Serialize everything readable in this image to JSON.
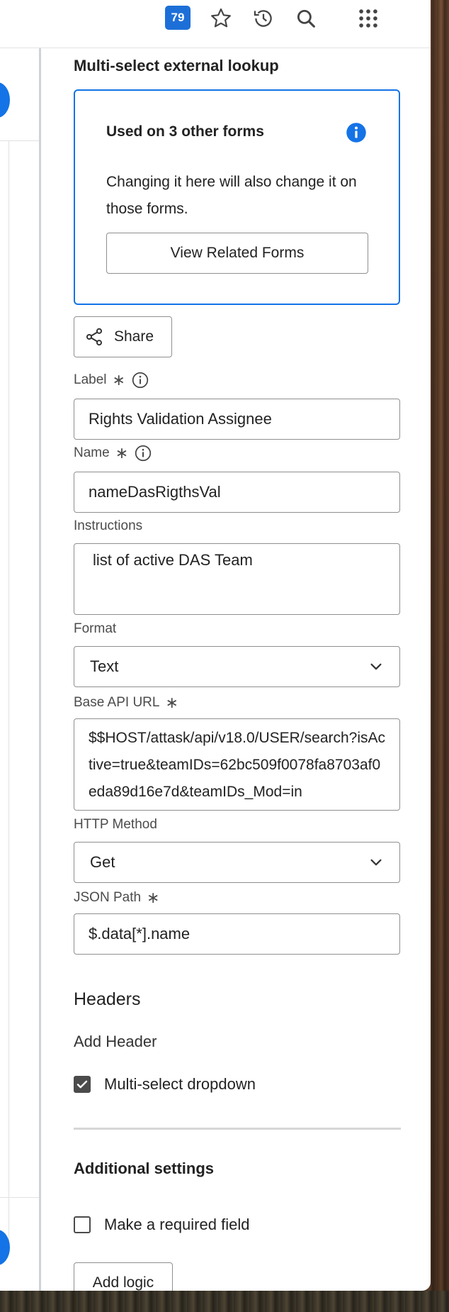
{
  "toolbar": {
    "notification_count": "79",
    "icons": [
      "star-icon",
      "history-icon",
      "search-icon",
      "apps-grid-icon"
    ]
  },
  "panel": {
    "title": "Multi-select external lookup",
    "info_card": {
      "title": "Used on 3 other forms",
      "body": "Changing it here will also change it on those forms.",
      "button_label": "View Related Forms"
    },
    "share_label": "Share",
    "fields": {
      "label": {
        "label": "Label",
        "value": "Rights Validation Assignee"
      },
      "name": {
        "label": "Name",
        "value": "nameDasRigthsVal"
      },
      "instructions": {
        "label": "Instructions",
        "value": "list of active DAS Team"
      },
      "format": {
        "label": "Format",
        "value": "Text"
      },
      "base_api_url": {
        "label": "Base API URL",
        "value": "$$HOST/attask/api/v18.0/USER/search?isActive=true&teamIDs=62bc509f0078fa8703af0eda89d16e7d&teamIDs_Mod=in"
      },
      "http_method": {
        "label": "HTTP Method",
        "value": "Get"
      },
      "json_path": {
        "label": "JSON Path",
        "value": "$.data[*].name"
      }
    },
    "headers": {
      "heading": "Headers",
      "add_header": "Add Header"
    },
    "multiselect": {
      "label": "Multi-select dropdown",
      "checked": true
    },
    "additional": {
      "heading": "Additional settings",
      "required": {
        "label": "Make a required field",
        "checked": false
      },
      "add_logic": "Add logic"
    }
  },
  "colors": {
    "accent": "#1473e6",
    "badge": "#1d6fd8",
    "border": "#8f8f8f",
    "text": "#222222"
  }
}
